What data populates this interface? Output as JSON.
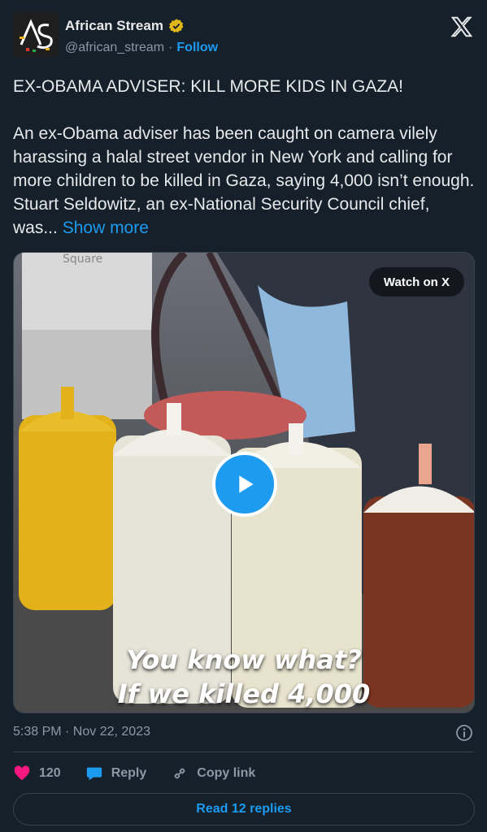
{
  "account": {
    "display_name": "African Stream",
    "handle": "@african_stream",
    "separator": "·",
    "follow_label": "Follow",
    "avatar_text": "AS"
  },
  "tweet": {
    "headline": "EX-OBAMA ADVISER: KILL MORE KIDS IN GAZA!",
    "body": "An ex-Obama adviser has been caught on camera vilely harassing a halal street vendor in New York and calling for more children to be killed in Gaza, saying 4,000 isn’t enough.  Stuart Seldowitz, an ex-National Security Council chief, was...",
    "show_more": "Show more"
  },
  "media": {
    "watch_label": "Watch on X",
    "caption_line1": "You know what?",
    "caption_line2": "If we killed 4,000",
    "sign_text": "Square"
  },
  "meta": {
    "timestamp": "5:38 PM · Nov 22, 2023"
  },
  "actions": {
    "likes": "120",
    "reply_label": "Reply",
    "copy_label": "Copy link"
  },
  "footer": {
    "read_replies": "Read 12 replies"
  },
  "colors": {
    "background": "#15202b",
    "accent": "#1d9bf0",
    "like": "#f91880"
  },
  "icons": [
    "verified-badge-icon",
    "x-logo-icon",
    "play-icon",
    "info-icon",
    "heart-icon",
    "reply-icon",
    "link-icon"
  ]
}
